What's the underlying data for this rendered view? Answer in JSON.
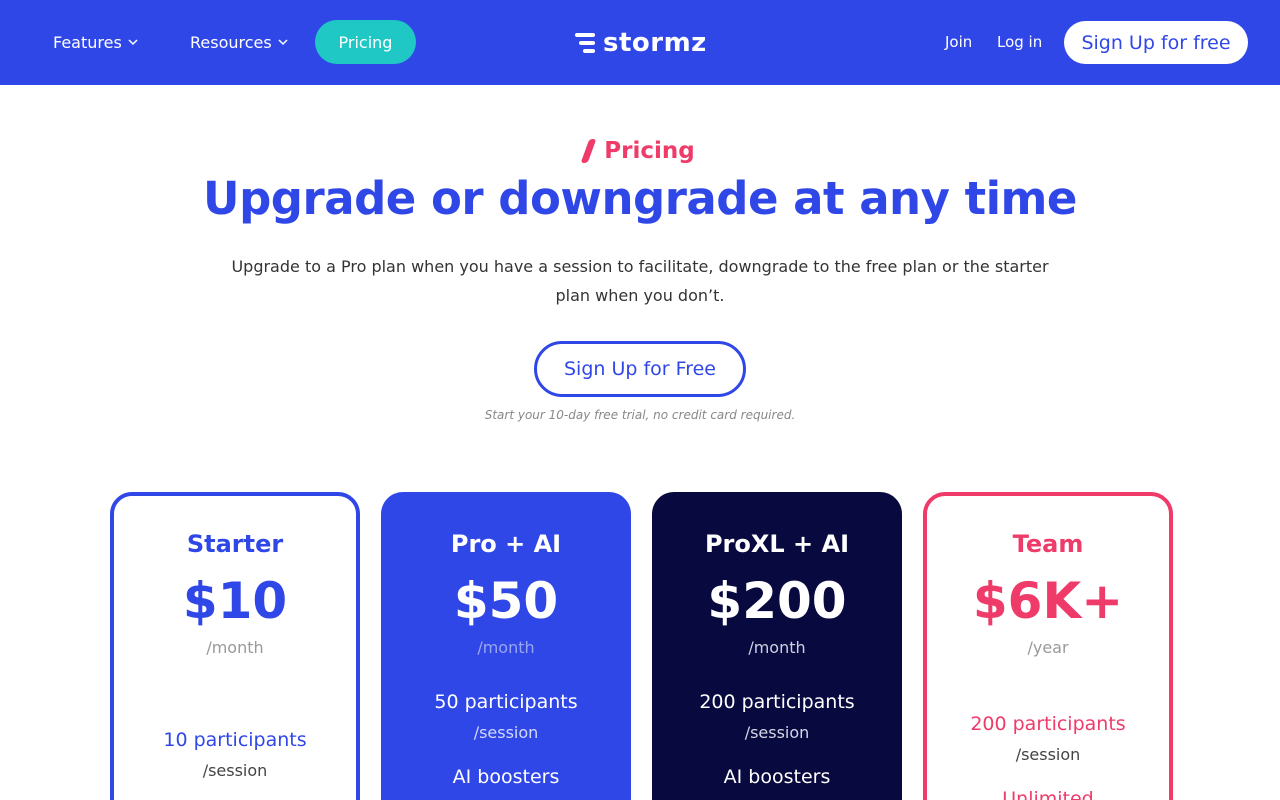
{
  "colors": {
    "primary": "#3047e8",
    "accent": "#1fc8c4",
    "pink": "#ef3b6a",
    "navy": "#07093f"
  },
  "nav": {
    "features": "Features",
    "resources": "Resources",
    "pricing": "Pricing",
    "logo": "stormz",
    "join": "Join",
    "login": "Log in",
    "signup": "Sign Up for free"
  },
  "hero": {
    "eyebrow": "Pricing",
    "title": "Upgrade or downgrade at any time",
    "subtitle": "Upgrade to a Pro plan when you have a session to facilitate, downgrade to the free plan or the starter plan when you don’t.",
    "cta": "Sign Up for Free",
    "note": "Start your 10-day free trial, no credit card required."
  },
  "plans": [
    {
      "name": "Starter",
      "price": "$10",
      "period": "/month",
      "participants": "10 participants",
      "per": "/session"
    },
    {
      "name": "Pro + AI",
      "price": "$50",
      "period": "/month",
      "participants": "50 participants",
      "per": "/session",
      "extra": "AI boosters"
    },
    {
      "name": "ProXL + AI",
      "price": "$200",
      "period": "/month",
      "participants": "200 participants",
      "per": "/session",
      "extra": "AI boosters"
    },
    {
      "name": "Team",
      "price": "$6K+",
      "period": "/year",
      "participants": "200 participants",
      "per": "/session",
      "extra": "Unlimited"
    }
  ]
}
